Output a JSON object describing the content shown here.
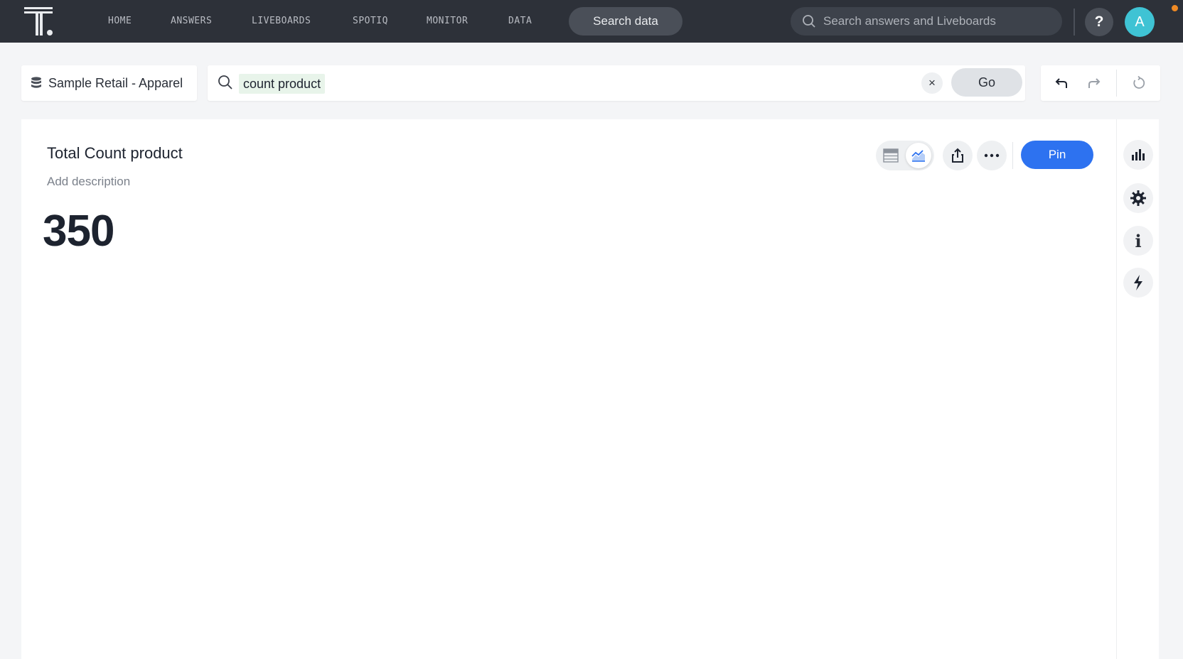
{
  "nav": {
    "items": [
      {
        "label": "HOME"
      },
      {
        "label": "ANSWERS"
      },
      {
        "label": "LIVEBOARDS"
      },
      {
        "label": "SPOTIQ"
      },
      {
        "label": "MONITOR"
      },
      {
        "label": "DATA"
      }
    ],
    "search_data_label": "Search data",
    "global_search_placeholder": "Search answers and Liveboards",
    "help_label": "?",
    "avatar_initial": "A"
  },
  "search": {
    "source_label": "Sample Retail - Apparel",
    "query_token": "count product",
    "clear_label": "×",
    "go_label": "Go"
  },
  "answer": {
    "title": "Total Count product",
    "description_placeholder": "Add description",
    "kpi_value": "350",
    "pin_label": "Pin"
  },
  "rail": {
    "info_label": "i"
  },
  "colors": {
    "topbar": "#2d3139",
    "primary": "#2d72f0",
    "avatar": "#3fc3d4",
    "token_bg": "#e8f4ea"
  }
}
